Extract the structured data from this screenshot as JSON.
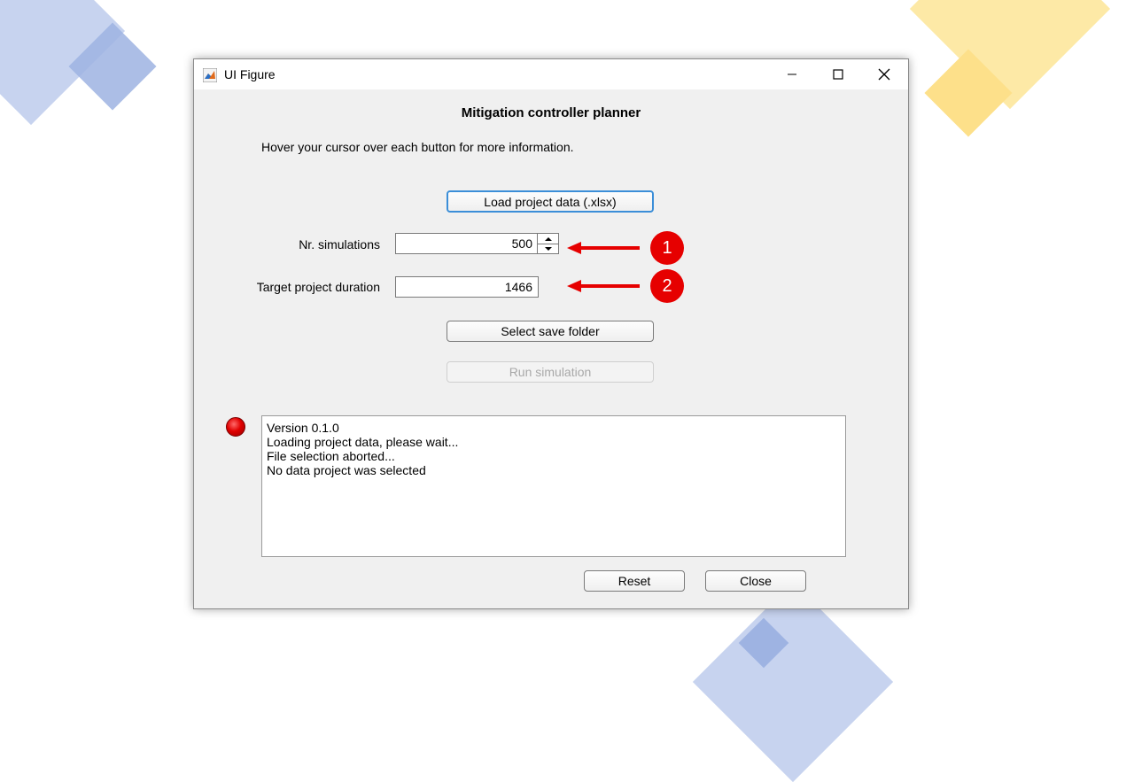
{
  "window": {
    "title": "UI Figure",
    "minimize_icon": "minimize-icon",
    "maximize_icon": "maximize-icon",
    "close_icon": "close-icon"
  },
  "app": {
    "heading": "Mitigation controller planner",
    "hint": "Hover your cursor over each button for more information.",
    "load_button": "Load project data (.xlsx)",
    "nr_simulations_label": "Nr. simulations",
    "nr_simulations_value": "500",
    "target_duration_label": "Target project duration",
    "target_duration_value": "1466",
    "save_folder_button": "Select save folder",
    "run_button": "Run simulation",
    "status_lamp_color": "#e00000",
    "log_lines": [
      "Version 0.1.0",
      "Loading project data, please wait...",
      "File selection aborted...",
      "No data project was selected"
    ],
    "reset_button": "Reset",
    "close_button": "Close"
  },
  "annotations": {
    "badge_1": "1",
    "badge_2": "2",
    "color": "#e60000"
  }
}
